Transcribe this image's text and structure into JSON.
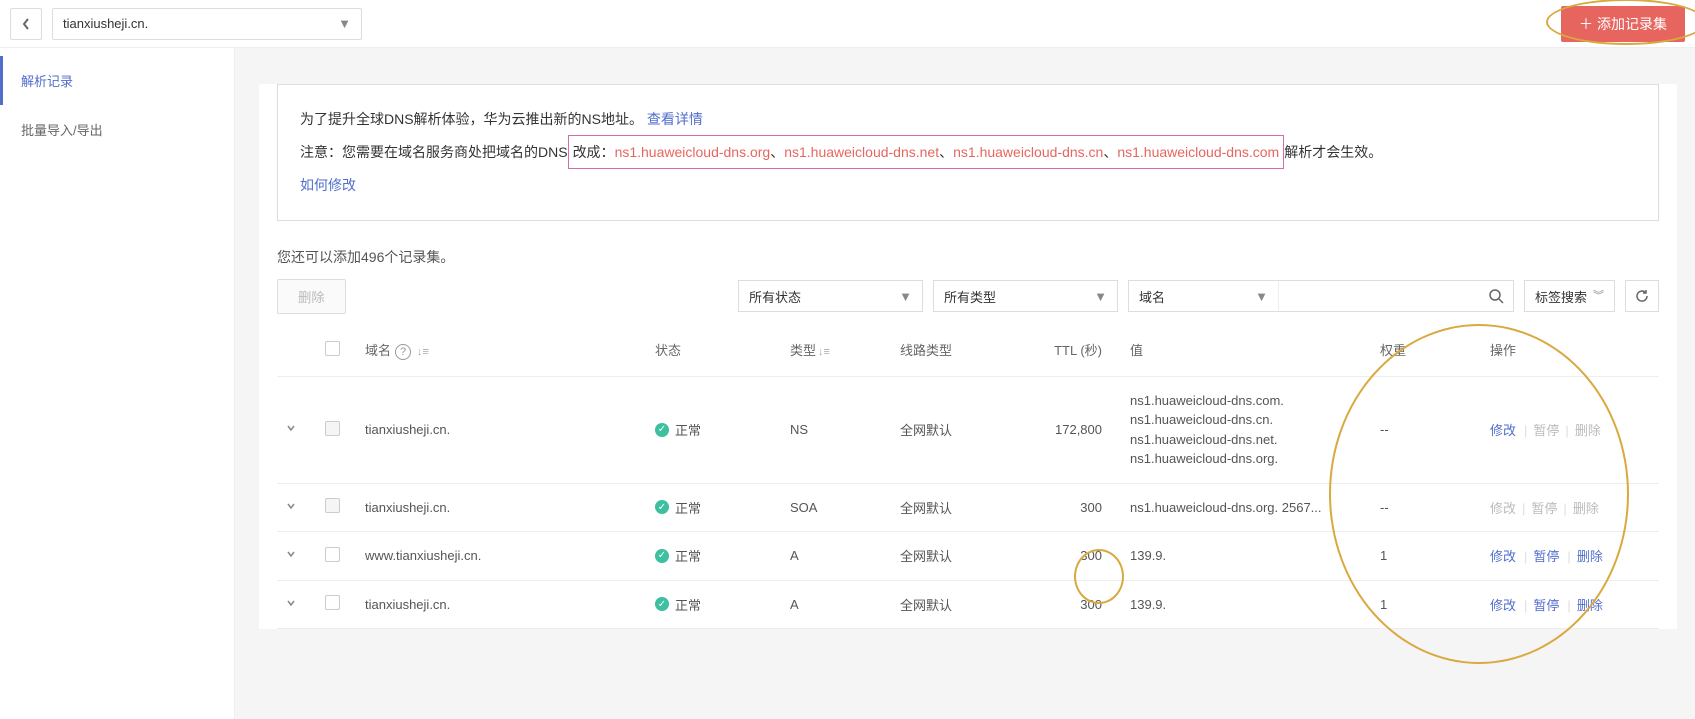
{
  "topbar": {
    "domain_selected": "tianxiusheji.cn.",
    "add_button": "添加记录集"
  },
  "sidebar": {
    "items": [
      {
        "label": "解析记录",
        "active": true
      },
      {
        "label": "批量导入/导出",
        "active": false
      }
    ]
  },
  "notice": {
    "line1_prefix": "为了提升全球DNS解析体验，华为云推出新的NS地址。",
    "line1_link": "查看详情",
    "line2_prefix": "注意：您需要在域名服务商处把域名的DNS",
    "line2_mid": "改成：",
    "dns_list": [
      "ns1.huaweicloud-dns.org",
      "ns1.huaweicloud-dns.net",
      "ns1.huaweicloud-dns.cn",
      "ns1.huaweicloud-dns.com"
    ],
    "line2_suffix": "解析才会生效。",
    "how_to": "如何修改"
  },
  "records_info": "您还可以添加496个记录集。",
  "toolbar": {
    "delete": "删除",
    "status_filter": "所有状态",
    "type_filter": "所有类型",
    "search_by": "域名",
    "search_placeholder": "",
    "tag_search": "标签搜索"
  },
  "table": {
    "headers": {
      "domain": "域名",
      "status": "状态",
      "type": "类型",
      "line": "线路类型",
      "ttl": "TTL (秒)",
      "value": "值",
      "weight": "权重",
      "ops": "操作"
    },
    "ops": {
      "modify": "修改",
      "pause": "暂停",
      "delete": "删除"
    },
    "rows": [
      {
        "domain": "tianxiusheji.cn.",
        "status": "正常",
        "type": "NS",
        "line": "全网默认",
        "ttl": "172,800",
        "value": [
          "ns1.huaweicloud-dns.com.",
          "ns1.huaweicloud-dns.cn.",
          "ns1.huaweicloud-dns.net.",
          "ns1.huaweicloud-dns.org."
        ],
        "weight": "--",
        "disabled_chk": true,
        "ops_enabled": {
          "modify": true,
          "pause": false,
          "delete": false
        }
      },
      {
        "domain": "tianxiusheji.cn.",
        "status": "正常",
        "type": "SOA",
        "line": "全网默认",
        "ttl": "300",
        "value": [
          "ns1.huaweicloud-dns.org. 2567..."
        ],
        "weight": "--",
        "disabled_chk": true,
        "ops_enabled": {
          "modify": false,
          "pause": false,
          "delete": false
        }
      },
      {
        "domain": "www.tianxiusheji.cn.",
        "status": "正常",
        "type": "A",
        "line": "全网默认",
        "ttl": "300",
        "value": [
          "139.9."
        ],
        "weight": "1",
        "disabled_chk": false,
        "ops_enabled": {
          "modify": true,
          "pause": true,
          "delete": true
        }
      },
      {
        "domain": "tianxiusheji.cn.",
        "status": "正常",
        "type": "A",
        "line": "全网默认",
        "ttl": "300",
        "value": [
          "139.9."
        ],
        "weight": "1",
        "disabled_chk": false,
        "ops_enabled": {
          "modify": true,
          "pause": true,
          "delete": true
        }
      }
    ]
  },
  "watermark": ""
}
